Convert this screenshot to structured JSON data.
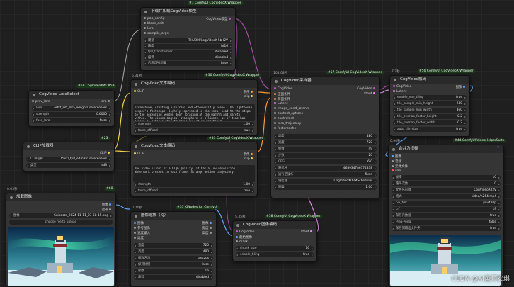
{
  "watermark": "CSDN @AI画师安琪",
  "nodes": {
    "download": {
      "badge": "#1 ComfyUI CogVideoX Wrapper",
      "title": "下载并加载CogVideo模型",
      "inputs": [
        "pab_config",
        "block_edit",
        "lora",
        "compile_args"
      ],
      "output": "CogVideo模型",
      "widgets": [
        {
          "label": "模型",
          "value": "THUDM/CogVideoX-5b-I2V"
        },
        {
          "label": "精度",
          "value": "bf16"
        },
        {
          "label": "fp8_transformer",
          "value": "disabled"
        },
        {
          "label": "编译",
          "value": "disabled"
        },
        {
          "label": "启用CPU卸载",
          "value": "false"
        }
      ]
    },
    "lora": {
      "badge": "#58 CogVideoXWra",
      "badge_num": "#59",
      "title": "CogVideo LoraSelect",
      "inputs": [
        "prev_lora"
      ],
      "output": "lora",
      "widgets": [
        {
          "label": "lora",
          "value": "orbit_left_lora_weights.safetensors"
        },
        {
          "label": "strength",
          "value": "0.6000"
        },
        {
          "label": "fuse_lora",
          "value": "false"
        }
      ]
    },
    "clip_loader": {
      "badge_num": "#23",
      "title": "CLIP加载器",
      "output": "CLIP",
      "widgets": [
        {
          "label": "CLIP名称",
          "value": "t5xxl_fp8_e4m3fn.safetensors"
        },
        {
          "label": "类型",
          "value": "sd3"
        }
      ]
    },
    "text_pos": {
      "time": "5.31秒",
      "badge": "#30 ComfyUI CogVideoX Wrapper",
      "title": "CogVideo文本编码",
      "input": "CLIP",
      "outputs": [
        "条件",
        "clip"
      ],
      "text": "Dreamshine, creating a surreal and otherworldly scene. The lighthouse keeper's footsteps, lightly imprinted in the snow, lead to the steps to the beckoning wooden door, bracing at the warmth and safety within. The cinema magical atmosphere in alliance, as if time has ceased to enhance this tranquility action unmatched",
      "widgets": [
        {
          "label": "strength",
          "value": "1.00"
        },
        {
          "label": "force_offload",
          "value": "true"
        }
      ]
    },
    "text_neg": {
      "badge": "#31 ComfyUI CogVideoX Wrapper",
      "title": "CogVideo文本编码",
      "input": "CLIP",
      "outputs": [
        "条件",
        "clip"
      ],
      "text": "The video is not of a high quality, it has a low resolution. Watermark present in each frame. Strange motion trajectory.",
      "widgets": [
        {
          "label": "strength",
          "value": "1.00"
        },
        {
          "label": "force_offload",
          "value": "true"
        }
      ]
    },
    "sampler": {
      "time": "101.08秒",
      "badge": "#57 ComfyUI CogVideoX Wrapper",
      "title": "CogVideo采样器",
      "inputs": [
        "CogVideo",
        "正面条件",
        "负面条件",
        "Latent",
        "image_cond_latents",
        "context_options",
        "controlnet",
        "tora_trajectory",
        "fastercache"
      ],
      "outputs": [
        "CogVideo",
        "Latent"
      ],
      "widgets": [
        {
          "label": "高度",
          "value": "480"
        },
        {
          "label": "宽度",
          "value": "720"
        },
        {
          "label": "帧数",
          "value": "49"
        },
        {
          "label": "步数",
          "value": "20"
        },
        {
          "label": "CFG",
          "value": "6.0"
        },
        {
          "label": "随机种",
          "value": "468934786374838"
        },
        {
          "label": "运行后操作",
          "value": "fixed"
        },
        {
          "label": "调度器",
          "value": "CogVideoXDPMScheduler"
        },
        {
          "label": "降噪",
          "value": "1.00"
        }
      ]
    },
    "decode": {
      "time": "7.7秒",
      "badge": "#50 ComfyUI CogVideoX Wrapper",
      "title": "CogVideo解码",
      "inputs": [
        "CogVideo",
        "Latent"
      ],
      "output": "图像",
      "widgets": [
        {
          "label": "enable_vae_tiling",
          "value": "true"
        },
        {
          "label": "tile_sample_min_height",
          "value": "240"
        },
        {
          "label": "tile_sample_min_width",
          "value": "360"
        },
        {
          "label": "tile_overlap_factor_height",
          "value": "0.2"
        },
        {
          "label": "tile_overlap_factor_width",
          "value": "0.2"
        },
        {
          "label": "auto_tile_size",
          "value": "true"
        }
      ]
    },
    "load_image": {
      "time": "0.03秒",
      "badge_num": "#60",
      "title": "加载图像",
      "outputs": [
        "图像",
        "遮罩"
      ],
      "file": "Snipaste_2024-11-11_23-58-15.png",
      "upload": "choose file to upload"
    },
    "resize": {
      "time": "0.04秒",
      "badge": "#37 KJNodes for ComfyUI",
      "title": "图像缩放（KJ）",
      "inputs": [
        "图像",
        "参考图像",
        "宽度输入",
        "高度"
      ],
      "outputs": [
        "图像",
        "宽度",
        "高度"
      ],
      "widgets": [
        {
          "label": "宽度",
          "value": "720"
        },
        {
          "label": "高度",
          "value": "480"
        },
        {
          "label": "缩放方法",
          "value": "lanczos"
        },
        {
          "label": "保持比例",
          "value": "false"
        },
        {
          "label": "除数",
          "value": "16"
        },
        {
          "label": "裁剪",
          "value": "disabled"
        }
      ]
    },
    "encode": {
      "time": "5.35秒",
      "badge": "#58 ComfyUI CogVideoX Wrapper",
      "title": "CogVideo图像编码",
      "inputs": [
        "CogVideo",
        "起始图像",
        "mask"
      ],
      "output": "Latent",
      "widgets": [
        {
          "label": "chunk_size",
          "value": "16"
        },
        {
          "label": "enable_tiling",
          "value": "true"
        }
      ]
    },
    "combine": {
      "time": "0.94秒",
      "badge": "#44 ComfyUI-VideoHelperSuite",
      "title": "合并为视频",
      "inputs": [
        "图像",
        "音频",
        "元件文件",
        "vae"
      ],
      "widgets": [
        {
          "label": "帧率",
          "value": "10"
        },
        {
          "label": "循环次数",
          "value": "0"
        },
        {
          "label": "文件名前缀",
          "value": "CogVideoX-I2V"
        },
        {
          "label": "格式",
          "value": "video/h264-mp4"
        },
        {
          "label": "pix_fmt",
          "value": "yuv420p"
        },
        {
          "label": "crf",
          "value": "19"
        },
        {
          "label": "保存元数据",
          "value": "true"
        },
        {
          "label": "Ping-Pong",
          "value": "false"
        },
        {
          "label": "保存到输出文件夹",
          "value": "true"
        }
      ]
    }
  },
  "colors": {
    "clip": "#f5d547",
    "model": "#c84fc8",
    "latent": "#e58cf0",
    "image": "#62a6ff",
    "cond": "#ff9a3c",
    "green": "#5c9a4a"
  }
}
